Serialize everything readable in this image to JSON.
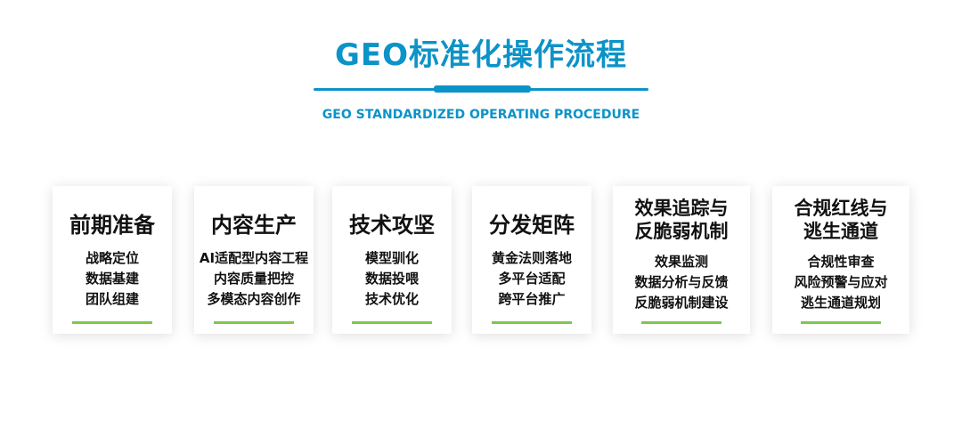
{
  "title": "GEO标准化操作流程",
  "subtitle": "GEO STANDARDIZED OPERATING PROCEDURE",
  "colors": {
    "accent": "#0c93c8",
    "underline": "#7ec850"
  },
  "cards": [
    {
      "title": "前期准备",
      "items": [
        "战略定位",
        "数据基建",
        "团队组建"
      ]
    },
    {
      "title": "内容生产",
      "items": [
        "AI适配型内容工程",
        "内容质量把控",
        "多模态内容创作"
      ]
    },
    {
      "title": "技术攻坚",
      "items": [
        "模型驯化",
        "数据投喂",
        "技术优化"
      ]
    },
    {
      "title": "分发矩阵",
      "items": [
        "黄金法则落地",
        "多平台适配",
        "跨平台推广"
      ]
    },
    {
      "title": "效果追踪与\n反脆弱机制",
      "items": [
        "效果监测",
        "数据分析与反馈",
        "反脆弱机制建设"
      ]
    },
    {
      "title": "合规红线与\n逃生通道",
      "items": [
        "合规性审查",
        "风险预警与应对",
        "逃生通道规划"
      ]
    }
  ]
}
